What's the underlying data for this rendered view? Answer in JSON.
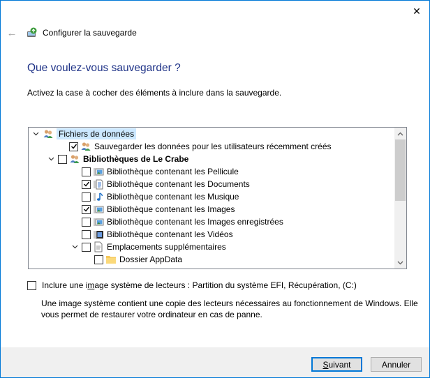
{
  "window": {
    "title": "Configurer la sauvegarde",
    "close_glyph": "✕",
    "back_glyph": "←"
  },
  "main": {
    "heading": "Que voulez-vous sauvegarder ?",
    "instruction": "Activez la case à cocher des éléments à inclure dans la sauvegarde."
  },
  "tree": {
    "items": [
      {
        "label": "Fichiers de données",
        "expander": "⌄",
        "checkbox": false,
        "checked": false,
        "icon": "users-icon",
        "selected": true
      },
      {
        "label": "Sauvegarder les données pour les utilisateurs récemment créés",
        "expander": "",
        "checkbox": true,
        "checked": true,
        "icon": "users-icon"
      },
      {
        "label": "Bibliothèques de Le Crabe",
        "expander": "⌄",
        "checkbox": true,
        "checked": false,
        "icon": "users-icon",
        "bold": true
      },
      {
        "label": "Bibliothèque contenant les Pellicule",
        "expander": "",
        "checkbox": true,
        "checked": false,
        "icon": "picture-library-icon"
      },
      {
        "label": "Bibliothèque contenant les Documents",
        "expander": "",
        "checkbox": true,
        "checked": true,
        "icon": "documents-library-icon"
      },
      {
        "label": "Bibliothèque contenant les Musique",
        "expander": "",
        "checkbox": true,
        "checked": false,
        "icon": "music-library-icon"
      },
      {
        "label": "Bibliothèque contenant les Images",
        "expander": "",
        "checkbox": true,
        "checked": true,
        "icon": "pictures-library-icon"
      },
      {
        "label": "Bibliothèque contenant les Images enregistrées",
        "expander": "",
        "checkbox": true,
        "checked": false,
        "icon": "saved-pictures-library-icon"
      },
      {
        "label": "Bibliothèque contenant les Vidéos",
        "expander": "",
        "checkbox": true,
        "checked": false,
        "icon": "videos-library-icon"
      },
      {
        "label": "Emplacements supplémentaires",
        "expander": "⌄",
        "checkbox": true,
        "checked": false,
        "icon": "locations-icon"
      },
      {
        "label": "Dossier AppData",
        "expander": "",
        "checkbox": true,
        "checked": false,
        "icon": "folder-icon"
      }
    ],
    "scroll_up": "▲",
    "scroll_down": "▼"
  },
  "system_image": {
    "label_pre": "Inclure une i",
    "label_accel": "m",
    "label_post": "age système de lecteurs : Partition du système EFI, Récupération, (C:)",
    "checked": false,
    "description": "Une image système contient une copie des lecteurs nécessaires au fonctionnement de Windows. Elle vous permet de restaurer votre ordinateur en cas de panne."
  },
  "footer": {
    "next_accel": "S",
    "next_rest": "uivant",
    "cancel_label": "Annuler"
  },
  "colors": {
    "accent": "#0078d7",
    "heading": "#1e3287",
    "selection": "#cce8ff",
    "footer_bg": "#f0f0f0"
  }
}
